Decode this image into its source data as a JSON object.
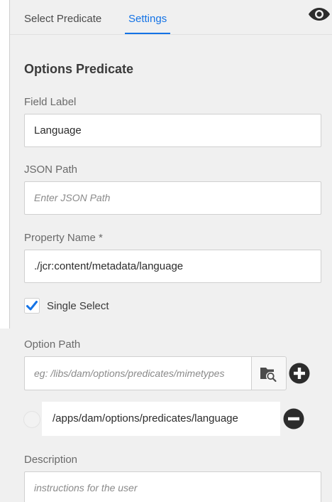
{
  "tabs": [
    {
      "label": "Select Predicate",
      "active": false
    },
    {
      "label": "Settings",
      "active": true
    }
  ],
  "colors": {
    "accent": "#1473e6",
    "icon_dark": "#2c2c2c"
  },
  "icons": {
    "preview": "eye-icon",
    "browse": "folder-search-icon",
    "add": "plus-circle-icon",
    "remove": "minus-circle-icon",
    "check": "checkmark-icon"
  },
  "section_title": "Options Predicate",
  "field_label": {
    "label": "Field Label",
    "value": "Language"
  },
  "json_path": {
    "label": "JSON Path",
    "placeholder": "Enter JSON Path"
  },
  "property_name": {
    "label": "Property Name *",
    "value": "./jcr:content/metadata/language"
  },
  "single_select": {
    "label": "Single Select",
    "checked": true
  },
  "option_path": {
    "label": "Option Path",
    "placeholder": "eg: /libs/dam/options/predicates/mimetypes",
    "items": [
      {
        "value": "/apps/dam/options/predicates/language",
        "selected": false
      }
    ]
  },
  "description": {
    "label": "Description",
    "placeholder": "instructions for the user"
  }
}
